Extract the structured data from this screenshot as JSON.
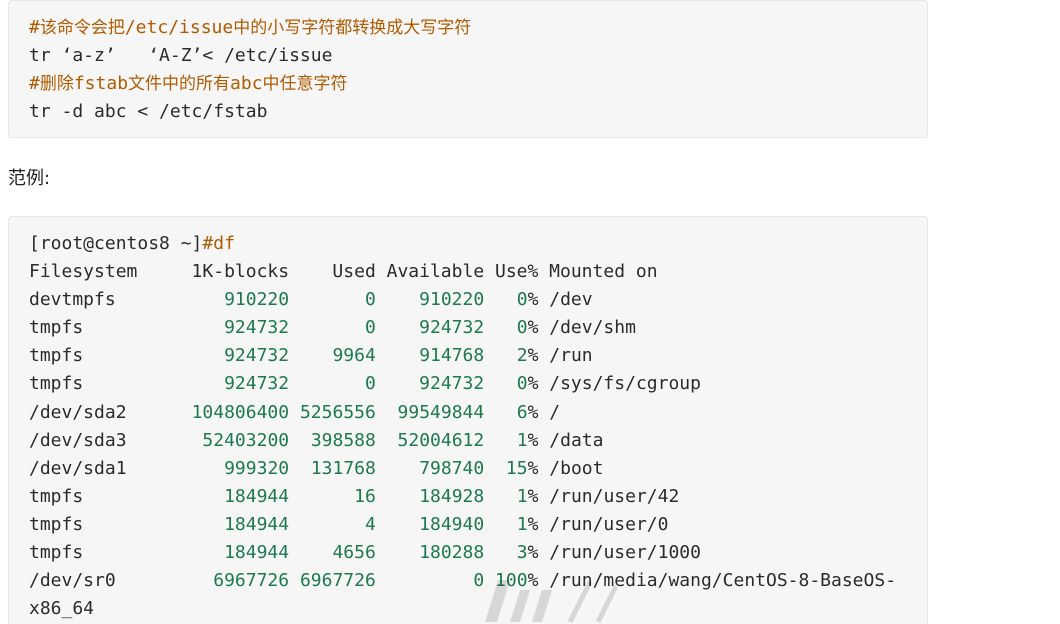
{
  "block1": {
    "lines": [
      {
        "type": "comment",
        "hash": "#",
        "parts": [
          {
            "t": "该命令会把",
            "zh": true
          },
          {
            "t": "/etc/issue",
            "zh": false
          },
          {
            "t": "中的小写字符都转换成大写字符",
            "zh": true
          }
        ]
      },
      {
        "type": "code",
        "text": "tr ‘a-z’   ‘A-Z’< /etc/issue"
      },
      {
        "type": "comment",
        "hash": "#",
        "parts": [
          {
            "t": "删除",
            "zh": true
          },
          {
            "t": "fstab",
            "zh": false
          },
          {
            "t": "文件中的所有",
            "zh": true
          },
          {
            "t": "abc",
            "zh": false
          },
          {
            "t": "中任意字符",
            "zh": true
          }
        ]
      },
      {
        "type": "code",
        "text": "tr -d abc < /etc/fstab"
      }
    ]
  },
  "example_label": "范例:",
  "block2": {
    "prompt": "[root@centos8 ~]",
    "command": "#df",
    "header": "Filesystem     1K-blocks    Used Available Use% Mounted on",
    "rows": [
      {
        "fs": "devtmpfs",
        "blocks": "910220",
        "used": "0",
        "avail": "910220",
        "use": "0%",
        "mount": "/dev"
      },
      {
        "fs": "tmpfs",
        "blocks": "924732",
        "used": "0",
        "avail": "924732",
        "use": "0%",
        "mount": "/dev/shm"
      },
      {
        "fs": "tmpfs",
        "blocks": "924732",
        "used": "9964",
        "avail": "914768",
        "use": "2%",
        "mount": "/run"
      },
      {
        "fs": "tmpfs",
        "blocks": "924732",
        "used": "0",
        "avail": "924732",
        "use": "0%",
        "mount": "/sys/fs/cgroup"
      },
      {
        "fs": "/dev/sda2",
        "blocks": "104806400",
        "used": "5256556",
        "avail": "99549844",
        "use": "6%",
        "mount": "/"
      },
      {
        "fs": "/dev/sda3",
        "blocks": "52403200",
        "used": "398588",
        "avail": "52004612",
        "use": "1%",
        "mount": "/data"
      },
      {
        "fs": "/dev/sda1",
        "blocks": "999320",
        "used": "131768",
        "avail": "798740",
        "use": "15%",
        "mount": "/boot"
      },
      {
        "fs": "tmpfs",
        "blocks": "184944",
        "used": "16",
        "avail": "184928",
        "use": "1%",
        "mount": "/run/user/42"
      },
      {
        "fs": "tmpfs",
        "blocks": "184944",
        "used": "4",
        "avail": "184940",
        "use": "1%",
        "mount": "/run/user/0"
      },
      {
        "fs": "tmpfs",
        "blocks": "184944",
        "used": "4656",
        "avail": "180288",
        "use": "3%",
        "mount": "/run/user/1000"
      },
      {
        "fs": "/dev/sr0",
        "blocks": "6967726",
        "used": "6967726",
        "avail": "0",
        "use": "100%",
        "mount": "/run/media/wang/CentOS-8-BaseOS-"
      }
    ],
    "continuation": "x86_64"
  },
  "colors": {
    "comment": "#b35b00",
    "number": "#1d7a4d",
    "text": "#2b2b2b",
    "code_bg": "#f6f6f7"
  }
}
